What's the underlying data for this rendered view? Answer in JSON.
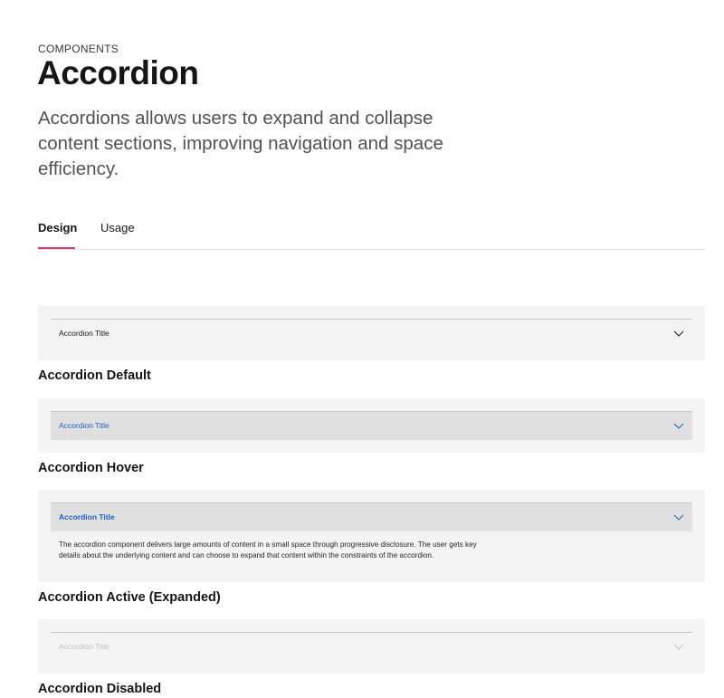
{
  "header": {
    "eyebrow": "COMPONENTS",
    "title": "Accordion",
    "lead": "Accordions allows users to expand and collapse content sections, improving navigation and space efficiency."
  },
  "tabs": [
    {
      "label": "Design",
      "selected": true
    },
    {
      "label": "Usage",
      "selected": false
    }
  ],
  "colors": {
    "accent": "#e5366b",
    "link_blue": "#1f5fc4",
    "panel_bg": "#f4f4f4",
    "hover_bg": "#e0e0e0"
  },
  "examples": [
    {
      "state": "default",
      "accordion_title": "Accordion Title",
      "caption": "Accordion Default",
      "icon": "chevron-down-icon"
    },
    {
      "state": "hover",
      "accordion_title": "Accordion Title",
      "caption": "Accordion Hover",
      "icon": "chevron-down-icon"
    },
    {
      "state": "active",
      "accordion_title": "Accordion Title",
      "caption": "Accordion Active (Expanded)",
      "icon": "chevron-down-icon",
      "body": "The accordion component delivers large amounts of content in a small space through progressive disclosure. The user gets key details about the underlying content and can choose to expand that content within the constraints of the accordion."
    },
    {
      "state": "disabled",
      "accordion_title": "Accordion Title",
      "caption": "Accordion Disabled",
      "icon": "chevron-down-icon"
    }
  ]
}
